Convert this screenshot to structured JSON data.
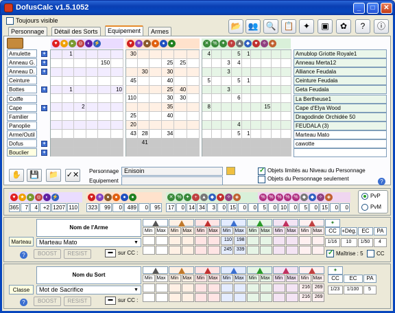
{
  "window": {
    "title": "DofusCalc v1.5.1052",
    "min": "_",
    "max": "□",
    "close": "✕"
  },
  "toujours_visible": "Toujours visible",
  "tabs": [
    "Personnage",
    "Détail des Sorts",
    "Equipement",
    "Armes"
  ],
  "toolbar_icons": [
    "open-folder-icon",
    "users-icon",
    "search-icon",
    "list-icon",
    "wand-icon",
    "chest-icon",
    "bag-icon",
    "help-icon",
    "info-icon"
  ],
  "slots": [
    "Amulette",
    "Anneau G.",
    "Anneau D.",
    "Ceinture",
    "Bottes",
    "Coiffe",
    "Cape",
    "Familier",
    "Panoplie",
    "Arme/Outil",
    "Dofus",
    "Bouclier"
  ],
  "grid1": [
    [
      "",
      "1",
      "",
      "",
      "",
      ""
    ],
    [
      "",
      "",
      "",
      "",
      "150",
      ""
    ],
    [
      "",
      "",
      "",
      "",
      "",
      ""
    ],
    [
      "",
      "",
      "",
      "",
      "",
      ""
    ],
    [
      "",
      "1",
      "",
      "",
      "",
      "10"
    ],
    [
      "",
      "",
      "",
      "",
      "",
      ""
    ],
    [
      "",
      "",
      "2",
      "",
      "",
      ""
    ],
    [
      "",
      "",
      "",
      "",
      "",
      ""
    ],
    [
      "",
      "",
      "",
      "",
      "",
      ""
    ],
    [
      "",
      "",
      "",
      "",
      "",
      ""
    ],
    [
      "",
      "",
      "",
      "",
      "",
      ""
    ],
    [
      "",
      "",
      "",
      "",
      "",
      ""
    ]
  ],
  "grid2": [
    [
      "30",
      "",
      "",
      "",
      "",
      ""
    ],
    [
      "",
      "",
      "",
      "25",
      "25",
      ""
    ],
    [
      "",
      "30",
      "",
      "30",
      "",
      ""
    ],
    [
      "45",
      "",
      "",
      "40",
      "",
      ""
    ],
    [
      "",
      "",
      "",
      "25",
      "40",
      ""
    ],
    [
      "110",
      "",
      "",
      "30",
      "30",
      ""
    ],
    [
      "",
      "",
      "",
      "35",
      "",
      ""
    ],
    [
      "25",
      "",
      "",
      "40",
      "",
      ""
    ],
    [
      "20",
      "",
      "",
      "",
      "",
      ""
    ],
    [
      "43",
      "28",
      "",
      "34",
      "",
      ""
    ],
    [
      "",
      "41",
      "",
      "",
      "",
      ""
    ],
    [
      "",
      "",
      "",
      "",
      "",
      ""
    ]
  ],
  "grid3": [
    [
      "4",
      "",
      "",
      "5",
      "1",
      "",
      "",
      "",
      ""
    ],
    [
      "",
      "",
      "3",
      "4",
      "",
      "",
      "",
      "",
      ""
    ],
    [
      "",
      "",
      "3",
      "",
      "",
      "",
      "",
      "",
      ""
    ],
    [
      "5",
      "",
      "",
      "5",
      "1",
      "",
      "",
      "",
      ""
    ],
    [
      "",
      "",
      "3",
      "",
      "",
      "",
      "",
      "",
      ""
    ],
    [
      "",
      "",
      "",
      "6",
      "",
      "",
      "",
      "",
      ""
    ],
    [
      "8",
      "",
      "",
      "",
      "",
      "",
      "15",
      "",
      ""
    ],
    [
      "",
      "",
      "",
      "",
      "",
      "",
      "",
      "",
      ""
    ],
    [
      "",
      "",
      "",
      "4",
      "",
      "",
      "",
      "",
      ""
    ],
    [
      "",
      "",
      "",
      "5",
      "1",
      "",
      "",
      "",
      ""
    ],
    [
      "",
      "",
      "",
      "",
      "",
      "",
      "",
      "",
      ""
    ],
    [
      "",
      "",
      "",
      "",
      "",
      "",
      "",
      "",
      ""
    ]
  ],
  "items": [
    "Amublop Griotte Royale1",
    "Anneau Merta12",
    "Alliance Feudala",
    "Ceinture Feudala",
    "Geta Feudala",
    "La Bertheuse1",
    "Cape d'Elya Wood",
    "Dragodinde Orchidée 50",
    "FEUDALA (3)",
    "Marteau Mato",
    "cawotte",
    ""
  ],
  "personnage_label": "Personnage",
  "personnage_value": "Enisoin",
  "equipement_label": "Equipement",
  "equipement_value": "",
  "limites_label": "Objets limités au Niveau du Personnage",
  "seulement_label": "Objets du Personnage seulement",
  "totals1": [
    "365",
    "7",
    "4",
    "+2",
    "1207",
    "110"
  ],
  "totals2": [
    "323",
    "99",
    "0",
    "489",
    "0",
    "95"
  ],
  "totals3": [
    "17",
    "0",
    "14",
    "34",
    "3",
    "0",
    "15",
    "0",
    "0"
  ],
  "totals4": [
    "5",
    "0",
    "10",
    "0",
    "5",
    "0",
    "15",
    "0",
    "0"
  ],
  "pvp": "PvP",
  "pvm": "PvM",
  "arme": {
    "title": "Nom de l'Arme",
    "tag": "Marteau",
    "name": "Marteau Mato",
    "boost": "BOOST",
    "resist": "RESIST",
    "surcc": "sur CC :",
    "row1": [
      "",
      "",
      "",
      "",
      "",
      "",
      "110",
      "198",
      "",
      "",
      "",
      "",
      "",
      ""
    ],
    "row2": [
      "",
      "",
      "",
      "",
      "",
      "",
      "245",
      "339",
      "",
      "",
      "",
      "",
      "",
      ""
    ],
    "cc": "1/16",
    "dmg": "10",
    "ec": "1/50",
    "pa": "4",
    "maitrise": "Maîtrise : 5",
    "cc_lbl": "CC",
    "plusdeg": "+Dég.",
    "ec_lbl": "EC",
    "pa_lbl": "PA",
    "cc2": "CC"
  },
  "sort": {
    "title": "Nom du Sort",
    "tag": "Classe",
    "name": "Mot de Sacrifice",
    "boost": "BOOST",
    "resist": "RESIST",
    "surcc": "sur CC :",
    "row1": [
      "",
      "",
      "",
      "",
      "",
      "",
      "",
      "",
      "",
      "",
      "",
      "",
      "216",
      "269"
    ],
    "row2": [
      "",
      "",
      "",
      "",
      "",
      "",
      "",
      "",
      "",
      "",
      "",
      "",
      "216",
      "269"
    ],
    "cc": "1/23",
    "ec": "1/100",
    "pa": "5",
    "cc_lbl": "CC",
    "ec_lbl": "EC",
    "pa_lbl": "PA"
  },
  "min": "Min",
  "max": "Max"
}
